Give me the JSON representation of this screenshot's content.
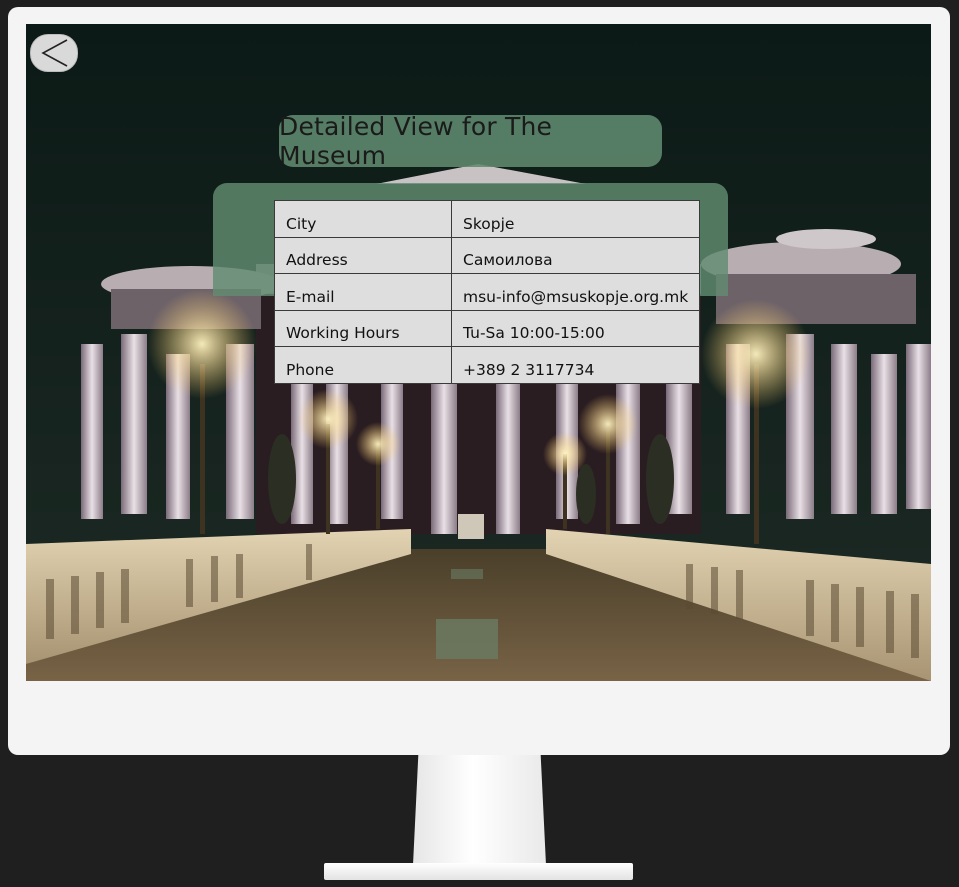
{
  "page": {
    "title": "Detailed View for The Museum",
    "back_icon": "chevron-left-icon"
  },
  "details": [
    {
      "label": "City",
      "value": "Skopje"
    },
    {
      "label": "Address",
      "value": "Самоилова"
    },
    {
      "label": "E-mail",
      "value": "msu-info@msuskopje.org.mk"
    },
    {
      "label": "Working Hours",
      "value": "Tu-Sa 10:00-15:00"
    },
    {
      "label": "Phone",
      "value": "+389 2 3117734"
    }
  ],
  "colors": {
    "panel": "#628c70",
    "table": "#dedede",
    "frame": "#f4f4f4",
    "background": "#1f1f1f"
  }
}
